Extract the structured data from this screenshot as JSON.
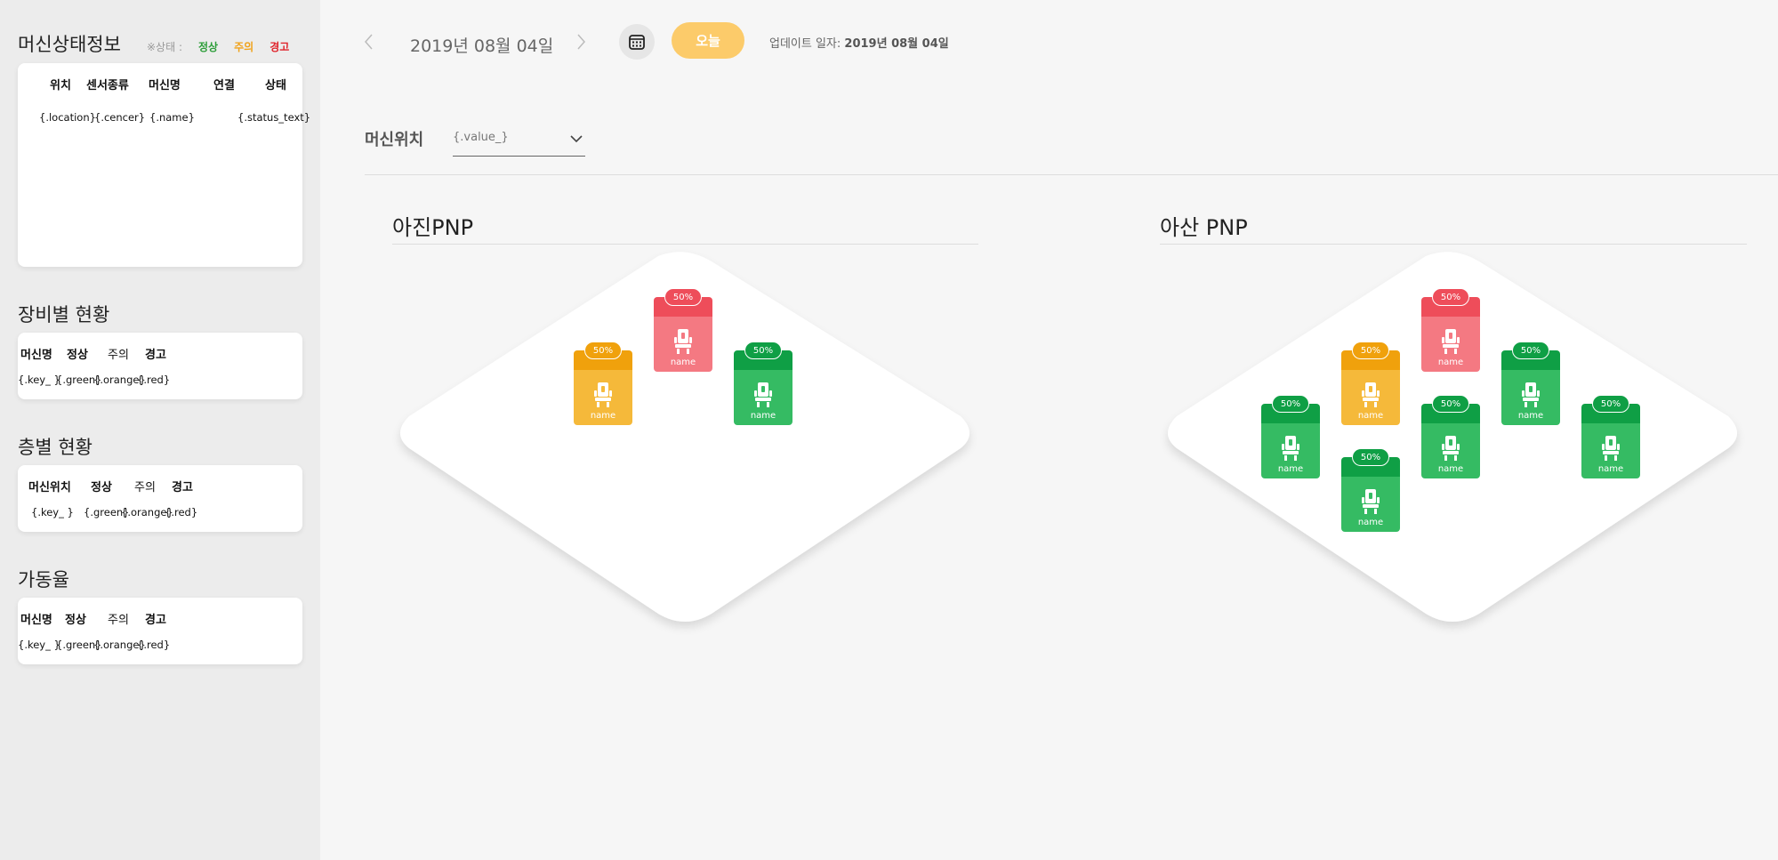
{
  "sidebar": {
    "machine_status": {
      "title": "머신상태정보",
      "legend": {
        "label": "※상태 :",
        "green": "정상",
        "orange": "주의",
        "red": "경고"
      },
      "headers": [
        "위치",
        "센서종류",
        "머신명",
        "연결",
        "상태"
      ],
      "row": [
        "{.location}",
        "{.cencer}",
        "{.name}",
        "",
        "{.status_text}"
      ]
    },
    "equipment": {
      "title": "장비별 현황",
      "headers": [
        "머신명",
        "정상",
        "주의",
        "경고"
      ],
      "row": [
        "{.key_ }",
        "{.green}",
        "{.orange}",
        "{.red}"
      ]
    },
    "floor": {
      "title": "층별 현황",
      "headers": [
        "머신위치",
        "정상",
        "주의",
        "경고"
      ],
      "row": [
        "{.key_ }",
        "{.green}",
        "{.orange}",
        "{.red}"
      ]
    },
    "operation": {
      "title": "가동율",
      "headers": [
        "머신명",
        "정상",
        "주의",
        "경고"
      ],
      "row": [
        "{.key_ }",
        "{.green}",
        "{.orange}",
        "{.red}"
      ]
    }
  },
  "toolbar": {
    "prev_icon": "chevron-left-icon",
    "date": "2019년 08월 04일",
    "next_icon": "chevron-right-icon",
    "calendar_icon": "calendar-icon",
    "today_label": "오늘",
    "update_label": "업데이트 일자:",
    "update_date": "2019년 08월 04일"
  },
  "location_filter": {
    "label": "머신위치",
    "value": "{.value_}",
    "icon": "chevron-down-icon"
  },
  "areas": [
    {
      "title": "아진PNP",
      "machines": [
        {
          "status": "orange",
          "percent": "50%",
          "name": "name"
        },
        {
          "status": "red",
          "percent": "50%",
          "name": "name"
        },
        {
          "status": "green",
          "percent": "50%",
          "name": "name"
        }
      ]
    },
    {
      "title": "아산 PNP",
      "machines": [
        {
          "status": "red",
          "percent": "50%",
          "name": "name"
        },
        {
          "status": "orange",
          "percent": "50%",
          "name": "name"
        },
        {
          "status": "green",
          "percent": "50%",
          "name": "name"
        },
        {
          "status": "green",
          "percent": "50%",
          "name": "name"
        },
        {
          "status": "green",
          "percent": "50%",
          "name": "name"
        },
        {
          "status": "green",
          "percent": "50%",
          "name": "name"
        },
        {
          "status": "green",
          "percent": "50%",
          "name": "name"
        }
      ]
    }
  ],
  "colors": {
    "green": "#35bb63",
    "orange": "#f5b93a",
    "red": "#f47982",
    "today": "#fccb6a"
  }
}
